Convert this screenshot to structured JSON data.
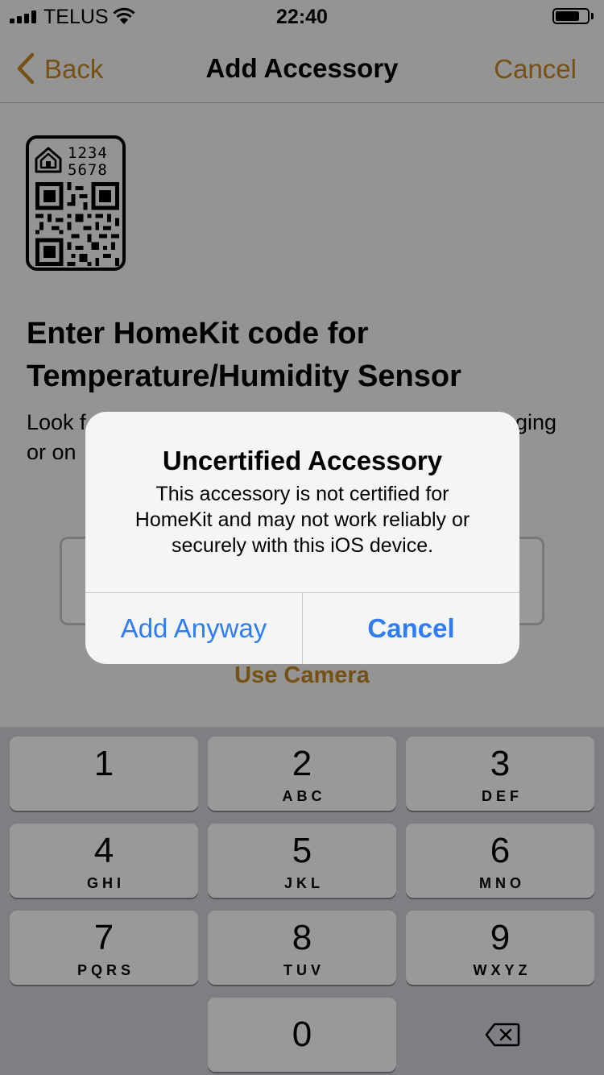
{
  "status_bar": {
    "carrier": "TELUS",
    "time": "22:40",
    "signal_bars": 4,
    "battery_level": 0.75
  },
  "nav": {
    "back_label": "Back",
    "title": "Add Accessory",
    "cancel_label": "Cancel"
  },
  "setup_code": {
    "code_line1": "1234",
    "code_line2": "5678"
  },
  "content": {
    "heading_line1": "Enter HomeKit code for",
    "heading_line2": "Temperature/Humidity Sensor",
    "instructions_start": "Look f",
    "instructions_end": "ging",
    "instructions_line2": "or on",
    "code_input_value": "",
    "use_camera_label": "Use Camera"
  },
  "keypad": {
    "keys": [
      {
        "digit": "1",
        "letters": ""
      },
      {
        "digit": "2",
        "letters": "ABC"
      },
      {
        "digit": "3",
        "letters": "DEF"
      },
      {
        "digit": "4",
        "letters": "GHI"
      },
      {
        "digit": "5",
        "letters": "JKL"
      },
      {
        "digit": "6",
        "letters": "MNO"
      },
      {
        "digit": "7",
        "letters": "PQRS"
      },
      {
        "digit": "8",
        "letters": "TUV"
      },
      {
        "digit": "9",
        "letters": "WXYZ"
      },
      {
        "digit": "0",
        "letters": ""
      }
    ],
    "delete_icon": "delete-backspace-icon"
  },
  "alert": {
    "title": "Uncertified Accessory",
    "message_line1": "This accessory is not certified for",
    "message_line2": "HomeKit and may not work reliably or",
    "message_line3": "securely with this iOS device.",
    "add_anyway_label": "Add Anyway",
    "cancel_label": "Cancel"
  },
  "colors": {
    "accent": "#c48724",
    "alert_button": "#2f7df6",
    "keypad_bg": "#d1d4d9"
  }
}
